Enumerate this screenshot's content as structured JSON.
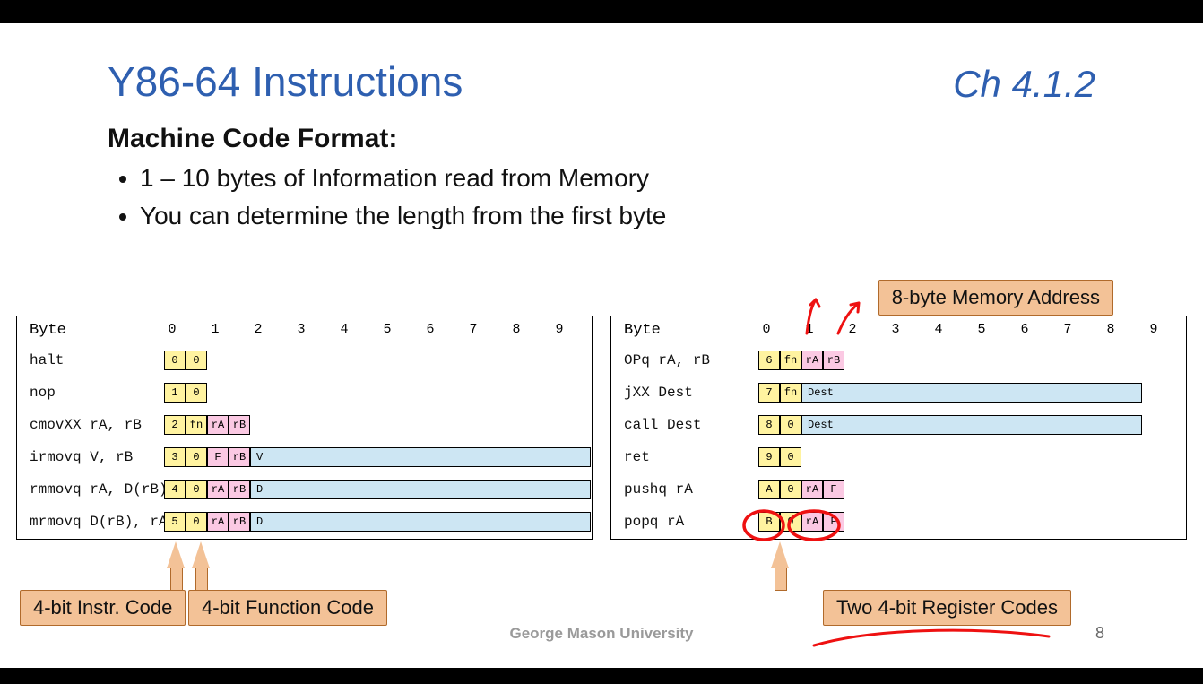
{
  "header": {
    "title": "Y86-64 Instructions",
    "chapter": "Ch 4.1.2"
  },
  "subtitle": "Machine Code Format:",
  "bullets": [
    "1 – 10 bytes of Information read from Memory",
    "You can determine the length from the first byte"
  ],
  "byte_header": "Byte",
  "byte_indices": [
    "0",
    "1",
    "2",
    "3",
    "4",
    "5",
    "6",
    "7",
    "8",
    "9"
  ],
  "left_rows": [
    {
      "mnem": "halt",
      "cells": [
        {
          "t": "0",
          "c": "y",
          "w": "h"
        },
        {
          "t": "0",
          "c": "y",
          "w": "h"
        }
      ]
    },
    {
      "mnem": "nop",
      "cells": [
        {
          "t": "1",
          "c": "y",
          "w": "h"
        },
        {
          "t": "0",
          "c": "y",
          "w": "h"
        }
      ]
    },
    {
      "mnem": "cmovXX rA, rB",
      "cells": [
        {
          "t": "2",
          "c": "y",
          "w": "h"
        },
        {
          "t": "fn",
          "c": "y",
          "w": "h"
        },
        {
          "t": "rA",
          "c": "p",
          "w": "h"
        },
        {
          "t": "rB",
          "c": "p",
          "w": "h"
        }
      ]
    },
    {
      "mnem": "irmovq V, rB",
      "cells": [
        {
          "t": "3",
          "c": "y",
          "w": "h"
        },
        {
          "t": "0",
          "c": "y",
          "w": "h"
        },
        {
          "t": "F",
          "c": "p",
          "w": "h"
        },
        {
          "t": "rB",
          "c": "p",
          "w": "h"
        },
        {
          "t": "V",
          "c": "b",
          "w": "L"
        }
      ]
    },
    {
      "mnem": "rmmovq rA, D(rB)",
      "cells": [
        {
          "t": "4",
          "c": "y",
          "w": "h"
        },
        {
          "t": "0",
          "c": "y",
          "w": "h"
        },
        {
          "t": "rA",
          "c": "p",
          "w": "h"
        },
        {
          "t": "rB",
          "c": "p",
          "w": "h"
        },
        {
          "t": "D",
          "c": "b",
          "w": "L"
        }
      ]
    },
    {
      "mnem": "mrmovq D(rB), rA",
      "cells": [
        {
          "t": "5",
          "c": "y",
          "w": "h"
        },
        {
          "t": "0",
          "c": "y",
          "w": "h"
        },
        {
          "t": "rA",
          "c": "p",
          "w": "h"
        },
        {
          "t": "rB",
          "c": "p",
          "w": "h"
        },
        {
          "t": "D",
          "c": "b",
          "w": "L"
        }
      ]
    }
  ],
  "right_rows": [
    {
      "mnem": "OPq rA, rB",
      "cells": [
        {
          "t": "6",
          "c": "y",
          "w": "h"
        },
        {
          "t": "fn",
          "c": "y",
          "w": "h"
        },
        {
          "t": "rA",
          "c": "p",
          "w": "h"
        },
        {
          "t": "rB",
          "c": "p",
          "w": "h"
        }
      ]
    },
    {
      "mnem": "jXX Dest",
      "cells": [
        {
          "t": "7",
          "c": "y",
          "w": "h"
        },
        {
          "t": "fn",
          "c": "y",
          "w": "h"
        },
        {
          "t": "Dest",
          "c": "b",
          "w": "L"
        }
      ]
    },
    {
      "mnem": "call Dest",
      "cells": [
        {
          "t": "8",
          "c": "y",
          "w": "h"
        },
        {
          "t": "0",
          "c": "y",
          "w": "h"
        },
        {
          "t": "Dest",
          "c": "b",
          "w": "L"
        }
      ]
    },
    {
      "mnem": "ret",
      "cells": [
        {
          "t": "9",
          "c": "y",
          "w": "h"
        },
        {
          "t": "0",
          "c": "y",
          "w": "h"
        }
      ]
    },
    {
      "mnem": "pushq rA",
      "cells": [
        {
          "t": "A",
          "c": "y",
          "w": "h"
        },
        {
          "t": "0",
          "c": "y",
          "w": "h"
        },
        {
          "t": "rA",
          "c": "p",
          "w": "h"
        },
        {
          "t": "F",
          "c": "p",
          "w": "h"
        }
      ]
    },
    {
      "mnem": "popq rA",
      "cells": [
        {
          "t": "B",
          "c": "y",
          "w": "h"
        },
        {
          "t": "0",
          "c": "y",
          "w": "h"
        },
        {
          "t": "rA",
          "c": "p",
          "w": "h"
        },
        {
          "t": "F",
          "c": "p",
          "w": "h"
        }
      ]
    }
  ],
  "callouts": {
    "mem_addr": "8-byte Memory Address",
    "instr_code": "4-bit Instr. Code",
    "func_code": "4-bit Function Code",
    "reg_codes": "Two 4-bit Register Codes"
  },
  "footer": "George Mason University",
  "pagenum": "8"
}
